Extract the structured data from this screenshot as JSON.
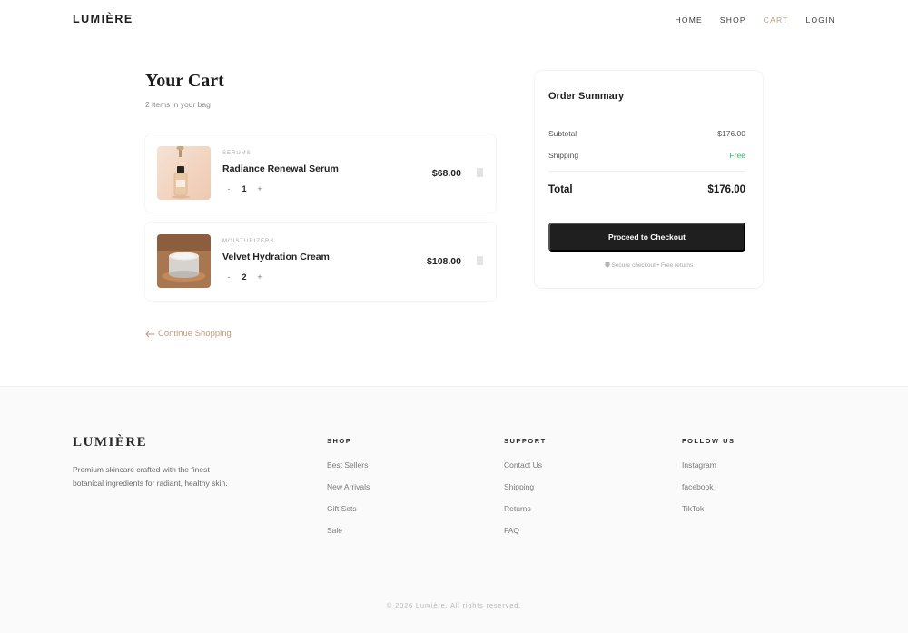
{
  "header": {
    "brand": "LUMIÈRE",
    "nav": [
      {
        "label": "HOME"
      },
      {
        "label": "SHOP"
      },
      {
        "label": "CART"
      },
      {
        "label": "LOGIN"
      }
    ],
    "active_color": "#c29a7a"
  },
  "cart": {
    "title": "Your Cart",
    "subtitle": "2 items in your bag",
    "items": [
      {
        "category": "SERUMS",
        "name": "Radiance Renewal Serum",
        "quantity": "1",
        "price": "$68.00",
        "minus": "-",
        "plus": "+"
      },
      {
        "category": "MOISTURIZERS",
        "name": "Velvet Hydration Cream",
        "quantity": "2",
        "price": "$108.00",
        "minus": "-",
        "plus": "+"
      }
    ],
    "continue_label": "Continue Shopping"
  },
  "summary": {
    "title": "Order Summary",
    "subtotal_label": "Subtotal",
    "subtotal_value": "$176.00",
    "shipping_label": "Shipping",
    "shipping_value": "Free",
    "total_label": "Total",
    "total_value": "$176.00",
    "checkout_label": "Proceed to Checkout",
    "secure_note": "Secure checkout • Free returns"
  },
  "footer": {
    "brand": "LUMIÈRE",
    "description": "Premium skincare crafted with the finest botanical ingredients for radiant, healthy skin.",
    "shop": {
      "heading": "SHOP",
      "links": [
        "Best Sellers",
        "New Arrivals",
        "Gift Sets",
        "Sale"
      ]
    },
    "support": {
      "heading": "SUPPORT",
      "links": [
        "Contact Us",
        "Shipping",
        "Returns",
        "FAQ"
      ]
    },
    "follow": {
      "heading": "FOLLOW US",
      "links": [
        "Instagram",
        "facebook",
        "TikTok"
      ]
    },
    "copyright": "© 2026 Lumière. All rights reserved."
  },
  "colors": {
    "accent": "#c29a7a",
    "free": "#33b36b",
    "button": "#1f1f1f"
  }
}
